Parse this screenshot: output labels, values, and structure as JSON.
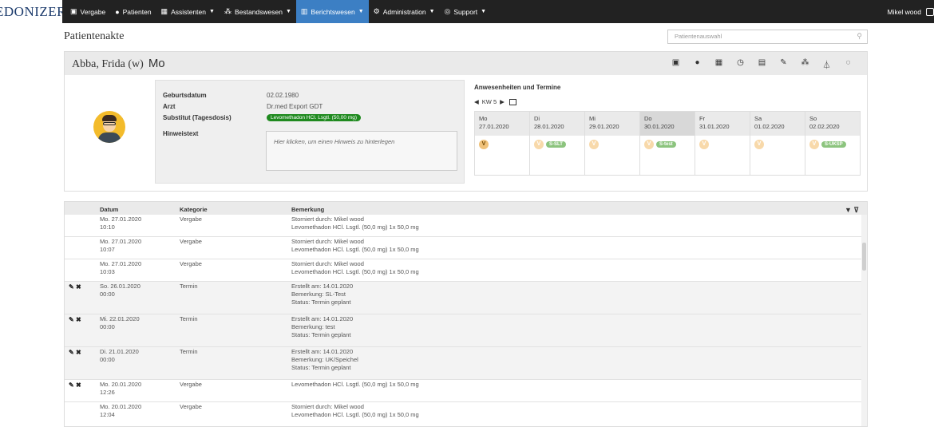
{
  "nav": {
    "logo": "EDONIZER",
    "items": [
      {
        "label": "Vergabe",
        "icon": "briefcase-icon",
        "caret": false,
        "active": false
      },
      {
        "label": "Patienten",
        "icon": "user-icon",
        "caret": false,
        "active": false
      },
      {
        "label": "Assistenten",
        "icon": "calculator-icon",
        "caret": true,
        "active": false
      },
      {
        "label": "Bestandswesen",
        "icon": "cubes-icon",
        "caret": true,
        "active": false
      },
      {
        "label": "Berichtswesen",
        "icon": "book-icon",
        "caret": true,
        "active": true
      },
      {
        "label": "Administration",
        "icon": "cogs-icon",
        "caret": true,
        "active": false
      },
      {
        "label": "Support",
        "icon": "lifebuoy-icon",
        "caret": true,
        "active": false
      }
    ],
    "user": "Mikel wood"
  },
  "page": {
    "title": "Patientenakte",
    "search_placeholder": "Patientenauswahl"
  },
  "patient": {
    "name": "Abba, Frida (w)",
    "day_tag": "Mo",
    "labels": {
      "dob": "Geburtsdatum",
      "doctor": "Arzt",
      "substitute": "Substitut (Tagesdosis)",
      "note": "Hinweistext"
    },
    "dob": "02.02.1980",
    "doctor": "Dr.med Export GDT",
    "substitute": "Levomethadon HCl. Lsgtl. (50,00 mg)",
    "note_placeholder": "Hier klicken, um einen Hinweis zu hinterlegen"
  },
  "attendance": {
    "title": "Anwesenheiten und Termine",
    "week_label": "KW 5",
    "days": [
      {
        "name": "Mo",
        "date": "27.01.2020",
        "v": "V",
        "chip": ""
      },
      {
        "name": "Di",
        "date": "28.01.2020",
        "v": "V",
        "chip": "S-SLT"
      },
      {
        "name": "Mi",
        "date": "29.01.2020",
        "v": "V",
        "chip": ""
      },
      {
        "name": "Do",
        "date": "30.01.2020",
        "v": "V",
        "chip": "S-test"
      },
      {
        "name": "Fr",
        "date": "31.01.2020",
        "v": "V",
        "chip": ""
      },
      {
        "name": "Sa",
        "date": "01.02.2020",
        "v": "V",
        "chip": ""
      },
      {
        "name": "So",
        "date": "02.02.2020",
        "v": "V",
        "chip": "S-UKSP"
      }
    ]
  },
  "table": {
    "headers": {
      "date": "Datum",
      "category": "Kategorie",
      "remark": "Bemerkung"
    },
    "rows": [
      {
        "date1": "Mo. 27.01.2020",
        "date2": "10:10",
        "category": "Vergabe",
        "lines": [
          "Storniert durch: Mikel wood",
          "Levomethadon HCl. Lsgtl. (50,0 mg) 1x 50,0 mg"
        ],
        "actions": false
      },
      {
        "date1": "Mo. 27.01.2020",
        "date2": "10:07",
        "category": "Vergabe",
        "lines": [
          "Storniert durch: Mikel wood",
          "Levomethadon HCl. Lsgtl. (50,0 mg) 1x 50,0 mg"
        ],
        "actions": false
      },
      {
        "date1": "Mo. 27.01.2020",
        "date2": "10:03",
        "category": "Vergabe",
        "lines": [
          "Storniert durch: Mikel wood",
          "Levomethadon HCl. Lsgtl. (50,0 mg) 1x 50,0 mg"
        ],
        "actions": false
      },
      {
        "date1": "So. 26.01.2020",
        "date2": "00:00",
        "category": "Termin",
        "lines": [
          "Erstellt am: 14.01.2020",
          "Bemerkung: SL-Test",
          "Status: Termin geplant"
        ],
        "actions": true
      },
      {
        "date1": "Mi. 22.01.2020",
        "date2": "00:00",
        "category": "Termin",
        "lines": [
          "Erstellt am: 14.01.2020",
          "Bemerkung: test",
          "Status: Termin geplant"
        ],
        "actions": true
      },
      {
        "date1": "Di. 21.01.2020",
        "date2": "00:00",
        "category": "Termin",
        "lines": [
          "Erstellt am: 14.01.2020",
          "Bemerkung: UK/Speichel",
          "Status: Termin geplant"
        ],
        "actions": true
      },
      {
        "date1": "Mo. 20.01.2020",
        "date2": "12:26",
        "category": "Vergabe",
        "lines": [
          "Levomethadon HCl. Lsgtl. (50,0 mg) 1x 50,0 mg"
        ],
        "actions": true
      },
      {
        "date1": "Mo. 20.01.2020",
        "date2": "12:04",
        "category": "Vergabe",
        "lines": [
          "Storniert durch: Mikel wood",
          "Levomethadon HCl. Lsgtl. (50,0 mg) 1x 50,0 mg"
        ],
        "actions": false
      }
    ]
  }
}
